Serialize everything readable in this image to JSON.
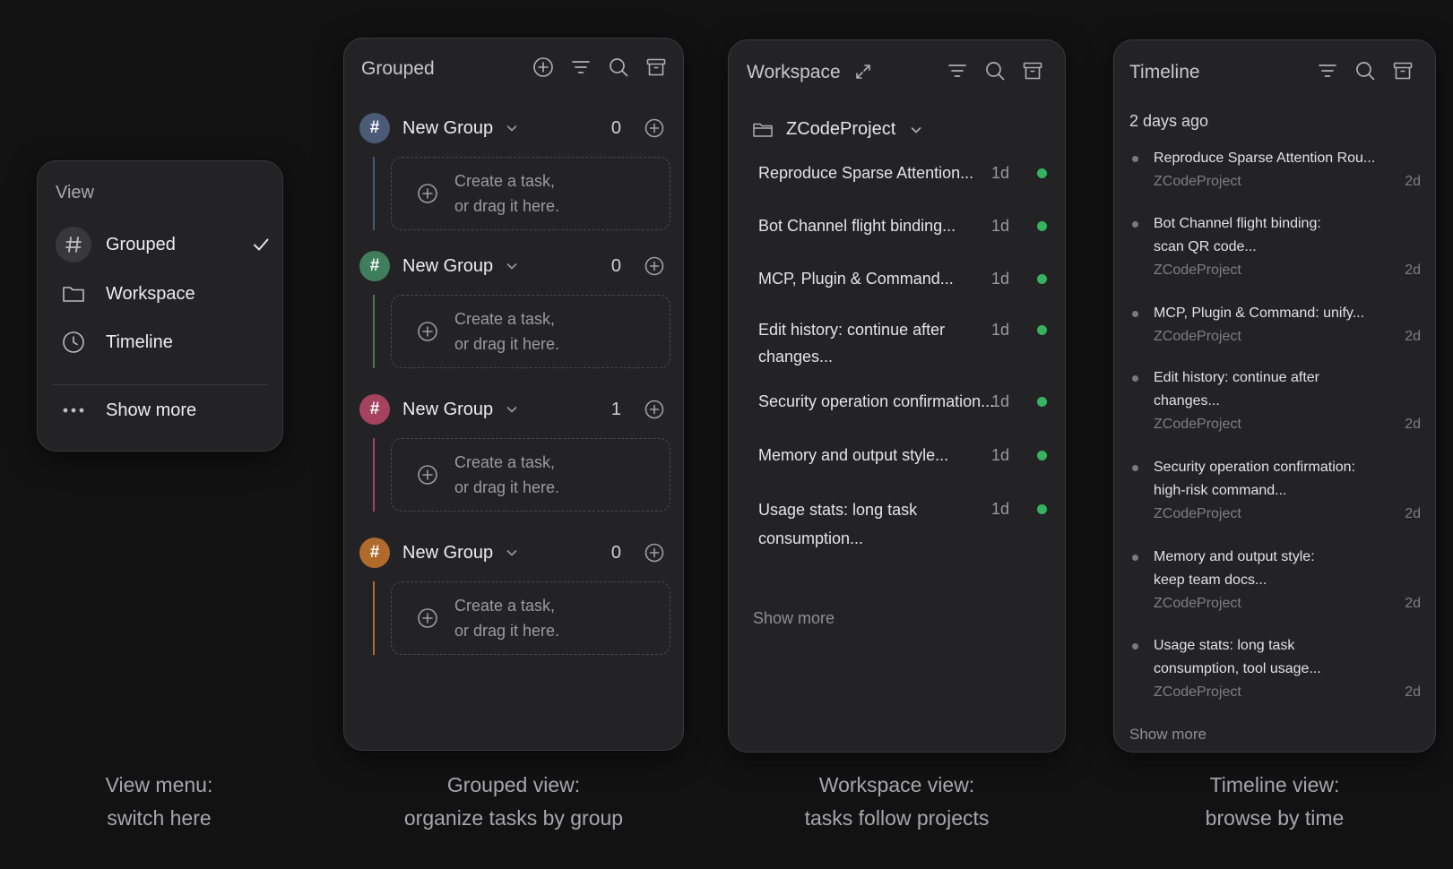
{
  "view_menu": {
    "title": "View",
    "items": [
      {
        "label": "Grouped",
        "selected": true,
        "icon": "hash-icon"
      },
      {
        "label": "Workspace",
        "selected": false,
        "icon": "folder-icon"
      },
      {
        "label": "Timeline",
        "selected": false,
        "icon": "clock-icon"
      }
    ],
    "show_more": "Show more"
  },
  "grouped": {
    "title": "Grouped",
    "placeholder_line1": "Create a task,",
    "placeholder_line2": "or drag it here.",
    "groups": [
      {
        "name": "New Group",
        "count": "0",
        "color": "#4a5a77"
      },
      {
        "name": "New Group",
        "count": "0",
        "color": "#3f7d5b"
      },
      {
        "name": "New Group",
        "count": "1",
        "color": "#a5435f"
      },
      {
        "name": "New Group",
        "count": "0",
        "color": "#b06a2c"
      }
    ]
  },
  "workspace": {
    "title": "Workspace",
    "project": "ZCodeProject",
    "tasks": [
      {
        "text": "Reproduce Sparse Attention...",
        "age": "1d"
      },
      {
        "text": "Bot Channel flight binding...",
        "age": "1d"
      },
      {
        "text": "MCP, Plugin & Command...",
        "age": "1d"
      },
      {
        "text": "Edit history: continue after changes...",
        "age": "1d"
      },
      {
        "text": "Security operation confirmation...",
        "age": "1d"
      },
      {
        "text": "Memory and output style...",
        "age": "1d"
      },
      {
        "text": "Usage stats: long task consumption...",
        "age": "1d"
      }
    ],
    "show_more": "Show more",
    "status_color": "#35b35f"
  },
  "timeline": {
    "title": "Timeline",
    "date_label": "2 days ago",
    "items": [
      {
        "line1": "Reproduce Sparse Attention Rou...",
        "line2": "",
        "project": "ZCodeProject",
        "age": "2d"
      },
      {
        "line1": "Bot Channel flight binding:",
        "line2": "scan QR code...",
        "project": "ZCodeProject",
        "age": "2d"
      },
      {
        "line1": "MCP, Plugin & Command: unify...",
        "line2": "",
        "project": "ZCodeProject",
        "age": "2d"
      },
      {
        "line1": "Edit history: continue after",
        "line2": "changes...",
        "project": "ZCodeProject",
        "age": "2d"
      },
      {
        "line1": "Security operation confirmation:",
        "line2": "high-risk command...",
        "project": "ZCodeProject",
        "age": "2d"
      },
      {
        "line1": "Memory and output style:",
        "line2": "keep team docs...",
        "project": "ZCodeProject",
        "age": "2d"
      },
      {
        "line1": "Usage stats: long task",
        "line2": "consumption, tool usage...",
        "project": "ZCodeProject",
        "age": "2d"
      }
    ],
    "show_more": "Show more"
  },
  "captions": [
    {
      "line1": "View menu:",
      "line2": "switch here"
    },
    {
      "line1": "Grouped view:",
      "line2": "organize tasks by group"
    },
    {
      "line1": "Workspace view:",
      "line2": "tasks follow projects"
    },
    {
      "line1": "Timeline view:",
      "line2": "browse by time"
    }
  ]
}
